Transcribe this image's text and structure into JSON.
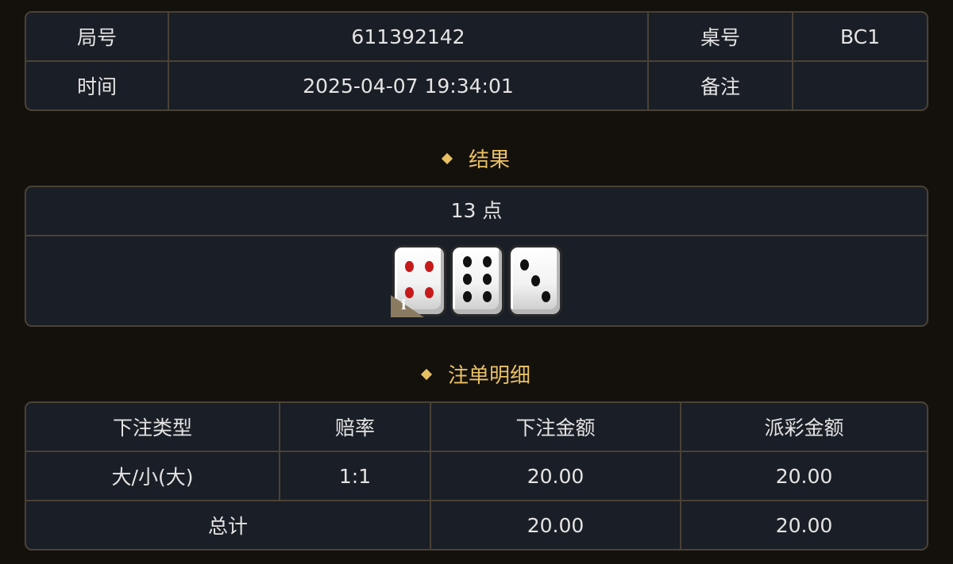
{
  "info": {
    "round_label": "局号",
    "round_value": "611392142",
    "table_label": "桌号",
    "table_value": "BC1",
    "time_label": "时间",
    "time_value": "2025-04-07 19:34:01",
    "remark_label": "备注",
    "remark_value": ""
  },
  "result": {
    "title": "结果",
    "points": "13 点",
    "dice": [
      4,
      6,
      3
    ],
    "info_badge": "i"
  },
  "bets": {
    "title": "注单明细",
    "headers": [
      "下注类型",
      "赔率",
      "下注金额",
      "派彩金额"
    ],
    "rows": [
      {
        "type": "大/小(大)",
        "odds": "1:1",
        "bet_amount": "20.00",
        "payout": "20.00"
      }
    ],
    "total": {
      "label": "总计",
      "bet_amount": "20.00",
      "payout": "20.00"
    }
  },
  "colors": {
    "background": "#14110d",
    "panel": "#1a1e26",
    "border": "#4a4236",
    "accent_gold": "#e8c063",
    "odds_red": "#d92b2b",
    "pip_red": "#c61a1a"
  },
  "icons": {
    "section_marker": "diamond-icon",
    "dice": "dice-icon",
    "info": "info-icon"
  }
}
